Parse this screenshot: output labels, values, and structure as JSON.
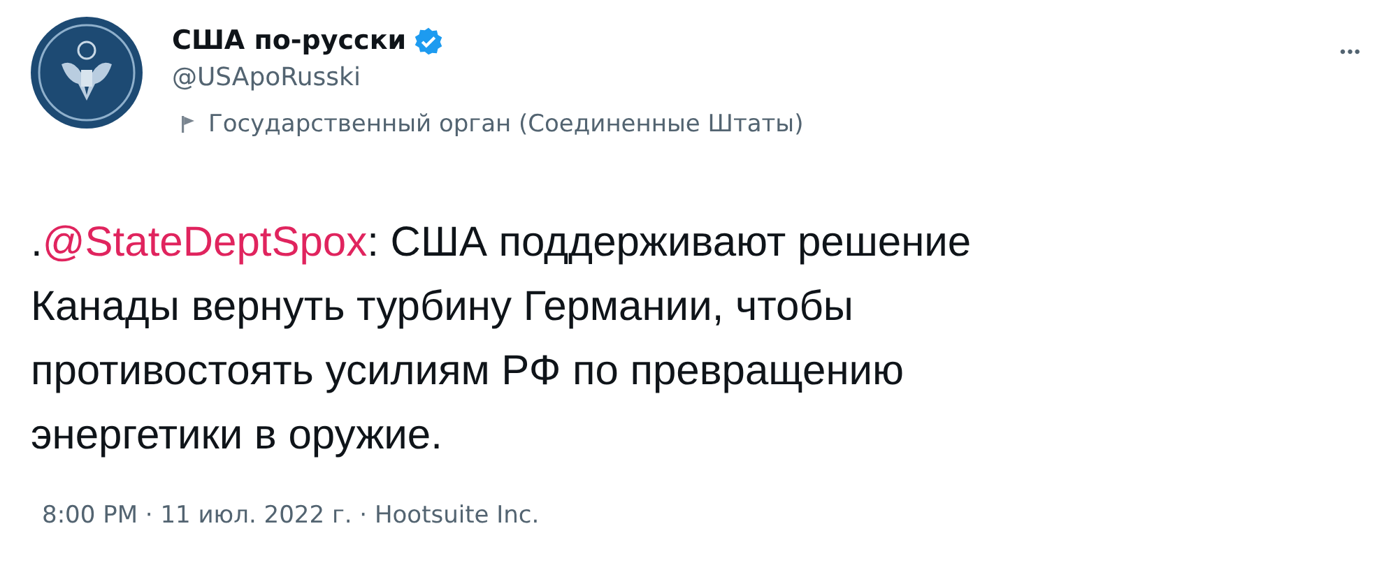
{
  "author": {
    "name": "США по-русски",
    "verified": true,
    "handle": "@USApoRusski",
    "label": "Государственный орган (Соединенные Штаты)"
  },
  "more_button": "•••",
  "tweet": {
    "prefix": ".",
    "mention": "@StateDeptSpox",
    "lines": [
      ": США поддерживают решение",
      "Канады вернуть турбину Германии, чтобы",
      "противостоять усилиям РФ по превращению",
      "энергетики в оружие."
    ]
  },
  "footer": "8:00 PM · 11 июл. 2022 г. · Hootsuite Inc."
}
